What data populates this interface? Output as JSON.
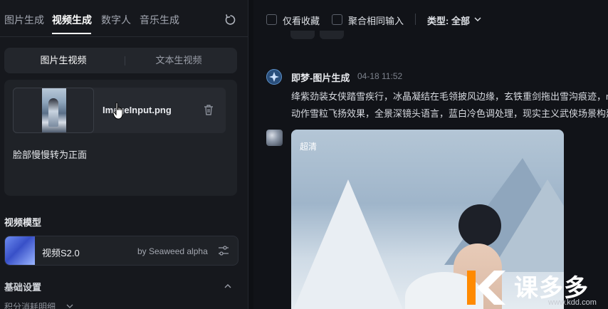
{
  "left": {
    "tabs": [
      {
        "label": "图片生成",
        "active": false
      },
      {
        "label": "视频生成",
        "active": true
      },
      {
        "label": "数字人",
        "active": false
      },
      {
        "label": "音乐生成",
        "active": false
      }
    ],
    "mode": {
      "image_to_video": "图片生视频",
      "text_to_video": "文本生视频",
      "active": "图片生视频"
    },
    "input": {
      "filename": "ImageInput.png",
      "prompt": "脸部慢慢转为正面"
    },
    "model_section_title": "视频模型",
    "model": {
      "name": "视频S2.0",
      "vendor": "by Seaweed alpha"
    },
    "more_settings": "基础设置",
    "credits_detail": "积分消耗明细"
  },
  "right": {
    "filters": {
      "favorites_only": "仅看收藏",
      "merge_same_input": "聚合相同输入",
      "type_label": "类型: 全部"
    },
    "message": {
      "sender": "即梦-图片生成",
      "time": "04-18  11:52",
      "lines": [
        "绛紫劲装女侠踏雪疾行，冰晶凝结在毛领披风边缘，玄铁重剑拖出雪沟痕迹，m",
        "动作雪粒飞扬效果，全景深镜头语言，蓝白冷色调处理，现实主义武侠场景构建"
      ]
    },
    "result": {
      "badge": "超清"
    }
  },
  "watermark": {
    "text": "课多多",
    "url": "www.kdd.com"
  },
  "colors": {
    "accent": "#ff8a00",
    "panel_bg": "#16181d",
    "main_bg": "#111318"
  }
}
